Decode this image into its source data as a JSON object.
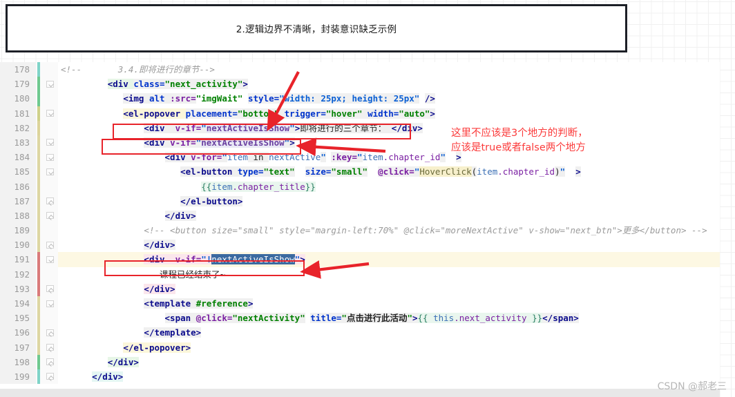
{
  "title_box": {
    "text": "2.逻辑边界不清晰，封装意识缺乏示例"
  },
  "watermark": "CSDN @郝老三",
  "annotations": {
    "note_line1": "这里不应该是3个地方的判断，",
    "note_line2": "应该是true或者false两个地方",
    "color": "#fb3b3b",
    "box_color": "#e8232a"
  },
  "editor": {
    "first_line": 178,
    "last_line": 199,
    "highlighted_line": 191,
    "selection_text": "nextActiveIsShow",
    "lines": [
      {
        "num": "178",
        "fold": "none",
        "stripe": "#7fd4c8"
      },
      {
        "num": "179",
        "fold": "down",
        "stripe": "#6fc98f"
      },
      {
        "num": "180",
        "fold": "none",
        "stripe": "#6fc98f"
      },
      {
        "num": "181",
        "fold": "down",
        "stripe": "#cfd18a"
      },
      {
        "num": "182",
        "fold": "none",
        "stripe": "#dcd49a"
      },
      {
        "num": "183",
        "fold": "down",
        "stripe": "#ddd6a2"
      },
      {
        "num": "184",
        "fold": "down",
        "stripe": "#ddd6a2"
      },
      {
        "num": "185",
        "fold": "down",
        "stripe": "#ddd6a2"
      },
      {
        "num": "186",
        "fold": "none",
        "stripe": "#ddd6a2"
      },
      {
        "num": "187",
        "fold": "up",
        "stripe": "#ddd6a2"
      },
      {
        "num": "188",
        "fold": "up",
        "stripe": "#ddd6a2"
      },
      {
        "num": "189",
        "fold": "none",
        "stripe": "#ddd6a2"
      },
      {
        "num": "190",
        "fold": "up",
        "stripe": "#ddd6a2"
      },
      {
        "num": "191",
        "fold": "down",
        "stripe": "#d97a7a"
      },
      {
        "num": "192",
        "fold": "none",
        "stripe": "#d97a7a"
      },
      {
        "num": "193",
        "fold": "up",
        "stripe": "#d97a7a"
      },
      {
        "num": "194",
        "fold": "down",
        "stripe": "#ddd6a2"
      },
      {
        "num": "195",
        "fold": "none",
        "stripe": "#ddd6a2"
      },
      {
        "num": "196",
        "fold": "up",
        "stripe": "#ddd6a2"
      },
      {
        "num": "197",
        "fold": "up",
        "stripe": "#ddd6a2"
      },
      {
        "num": "198",
        "fold": "up",
        "stripe": "#6fc98f"
      },
      {
        "num": "199",
        "fold": "up",
        "stripe": "#7fd4c8"
      }
    ],
    "code_text": [
      "<!--       3.4.即将进行的章节-->",
      "    <div class=\"next_activity\">",
      "        <img alt :src=\"imgWait\" style=\"width: 25px; height: 25px\" />",
      "        <el-popover placement=\"bottom\" trigger=\"hover\" width=\"auto\">",
      "            <div  v-if=\"nextActiveIsShow\">即将进行的三个章节：</div>",
      "            <div v-if=\"nextActiveIsShow\">",
      "                <div v-for=\"item in nextActive\" :key=\"item.chapter_id\"  >",
      "                    <el-button type=\"text\"  size=\"small\"  @click=\"HoverClick(item.chapter_id)\"  >",
      "                        {{item.chapter_title}}",
      "                    </el-button>",
      "                </div>",
      "                <!-- <button size=\"small\" style=\"margin-left:70%\" @click=\"moreNextActive\" v-show=\"next_btn\">更多</button> -->",
      "            </div>",
      "            <div  v-if=\"!nextActiveIsShow\">",
      "                课程已经结束了~",
      "            </div>",
      "            <template #reference>",
      "                <span @click=\"nextActivity\" title=\"点击进行此活动\">{{ this.next_activity }}</span>",
      "            </template>",
      "        </el-popover>",
      "    </div>",
      "</div>"
    ]
  }
}
